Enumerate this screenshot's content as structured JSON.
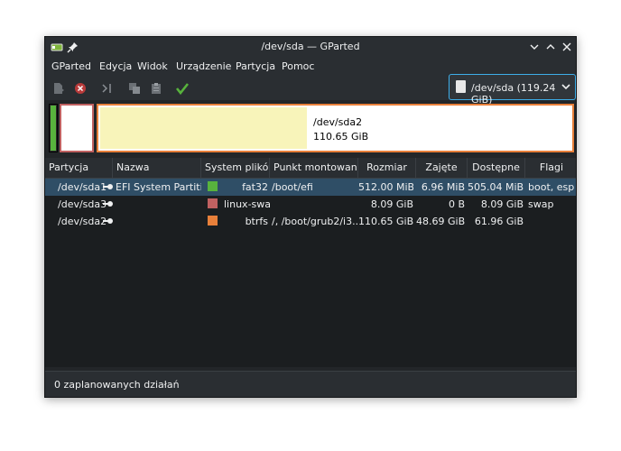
{
  "window": {
    "title": "/dev/sda — GParted"
  },
  "menu": [
    "GParted",
    "Edycja",
    "Widok",
    "Urządzenie",
    "Partycja",
    "Pomoc"
  ],
  "toolbar": {
    "icons": [
      "new-partition-icon",
      "delete-icon",
      "resize-move-icon",
      "copy-icon",
      "paste-icon",
      "apply-icon"
    ]
  },
  "device": {
    "selected": "/dev/sda (119.24 GiB)"
  },
  "diskmap": {
    "selected_partition": "/dev/sda2",
    "selected_size": "110.65 GiB",
    "sda2_used_fraction": 0.44
  },
  "columns": [
    "Partycja",
    "Nazwa",
    "System plików",
    "Punkt montowania",
    "Rozmiar",
    "Zajęte",
    "Dostępne",
    "Flagi"
  ],
  "partitions": [
    {
      "partition": "/dev/sda1",
      "name": "EFI System Partition",
      "fs": "fat32",
      "fs_color": "#58b33d",
      "mount": "/boot/efi",
      "size": "512.00 MiB",
      "used": "6.96 MiB",
      "free": "505.04 MiB",
      "flags": "boot, esp",
      "selected": true
    },
    {
      "partition": "/dev/sda3",
      "name": "",
      "fs": "linux-swap",
      "fs_color": "#c06161",
      "mount": "",
      "size": "8.09 GiB",
      "used": "0 B",
      "free": "8.09 GiB",
      "flags": "swap",
      "selected": false
    },
    {
      "partition": "/dev/sda2",
      "name": "",
      "fs": "btrfs",
      "fs_color": "#e8803a",
      "mount": "/, /boot/grub2/i3...",
      "size": "110.65 GiB",
      "used": "48.69 GiB",
      "free": "61.96 GiB",
      "flags": "",
      "selected": false
    }
  ],
  "status": {
    "text": "0 zaplanowanych działań"
  },
  "colors": {
    "accent": "#3daee9",
    "selection": "#2f4e66",
    "apply_green": "#58b33d"
  }
}
